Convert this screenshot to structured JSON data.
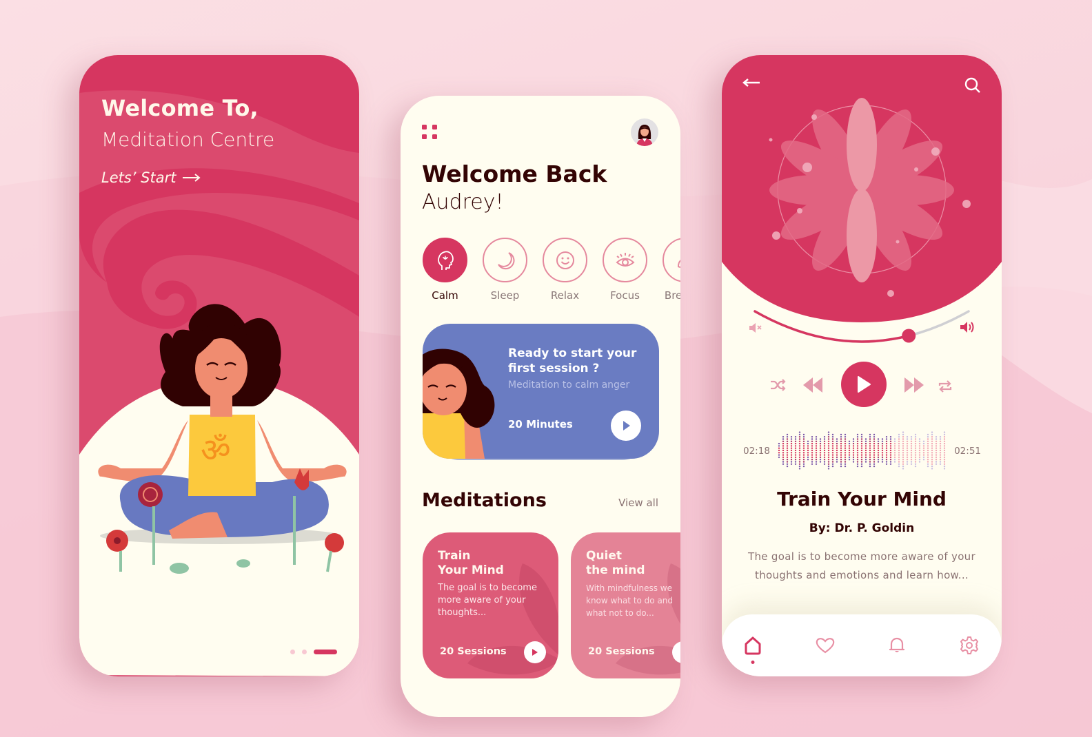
{
  "colors": {
    "primary": "#d63660",
    "primary_light": "#e5899e",
    "cream": "#fffdf0",
    "dark_text": "#330404",
    "muted_text": "#8a7272",
    "session_card": "#6a7cc2",
    "med_card_1": "#dd5b78",
    "med_card_2": "#e48396"
  },
  "onboarding": {
    "title": "Welcome To,",
    "subtitle": "Meditation Centre",
    "start_label": "Lets’ Start",
    "arrow_icon": "arrow-right-icon",
    "pager": {
      "total": 3,
      "active": 3
    }
  },
  "home": {
    "menu_icon": "grid-menu-icon",
    "avatar_icon": "user-avatar",
    "greeting": "Welcome Back",
    "user_name": "Audrey!",
    "categories": [
      {
        "label": "Calm",
        "icon": "head-lotus-icon",
        "active": true
      },
      {
        "label": "Sleep",
        "icon": "moon-icon",
        "active": false
      },
      {
        "label": "Relax",
        "icon": "smile-icon",
        "active": false
      },
      {
        "label": "Focus",
        "icon": "eye-icon",
        "active": false
      },
      {
        "label": "Breathe",
        "icon": "lungs-icon",
        "active": false
      }
    ],
    "session_card": {
      "title": "Ready to start your first session ?",
      "subtitle": "Meditation to calm anger",
      "duration": "20 Minutes",
      "play_icon": "play-icon"
    },
    "meditations_heading": "Meditations",
    "view_all": "View all",
    "meditations": [
      {
        "title": "Train Your Mind",
        "description": "The goal is to become more aware of your thoughts...",
        "sessions": "20 Sessions"
      },
      {
        "title": "Quiet the mind",
        "description": "With mindfulness we know what to do and what not to do...",
        "sessions": "20 Sessions"
      }
    ]
  },
  "player": {
    "back_icon": "arrow-left-icon",
    "search_icon": "search-icon",
    "volume_level": 0.72,
    "current_time": "02:18",
    "total_time": "02:51",
    "progress": 0.68,
    "title": "Train Your Mind",
    "author": "By: Dr. P. Goldin",
    "description": "The goal is to become more aware of your thoughts and emotions and learn how...",
    "controls": [
      "shuffle",
      "previous",
      "play",
      "next",
      "repeat"
    ],
    "nav": [
      {
        "icon": "home-icon",
        "active": true
      },
      {
        "icon": "heart-icon",
        "active": false
      },
      {
        "icon": "bell-icon",
        "active": false
      },
      {
        "icon": "gear-icon",
        "active": false
      }
    ]
  }
}
